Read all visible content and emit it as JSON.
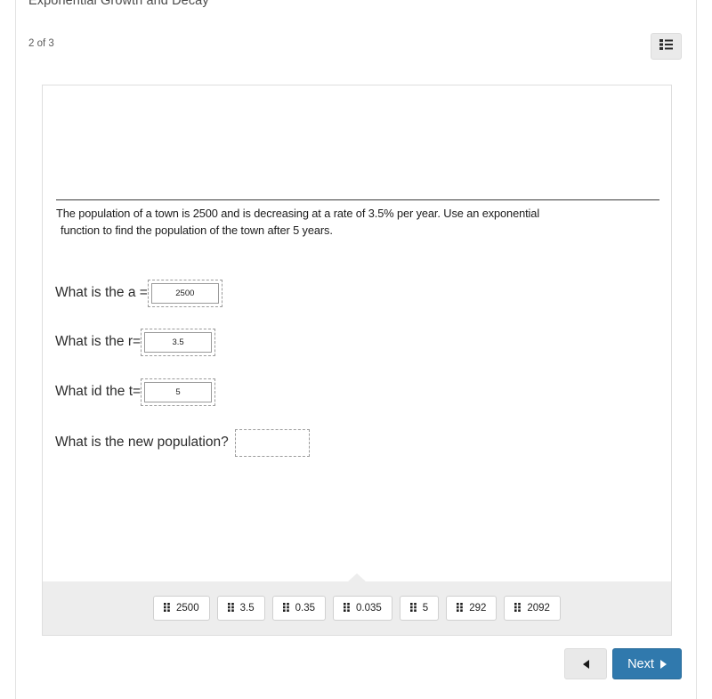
{
  "header": {
    "title": "Exponential Growth and Decay",
    "progress": "2 of 3",
    "menu_icon": "list-icon"
  },
  "prompt": {
    "line1": "The population of a town is 2500 and is decreasing at a rate of 3.5% per year.  Use an exponential",
    "line2": "function to find the population of the town after 5 years."
  },
  "questions": [
    {
      "label": "What is the a =",
      "value": "2500",
      "filled": true
    },
    {
      "label": "What is the r=",
      "value": "3.5",
      "filled": true
    },
    {
      "label": "What id the t=",
      "value": "5",
      "filled": true
    },
    {
      "label": "What is the new population?",
      "value": "",
      "filled": false
    }
  ],
  "tray": {
    "tokens": [
      {
        "label": "2500",
        "grip_icon": "drag-handle-icon"
      },
      {
        "label": "3.5",
        "grip_icon": "drag-handle-icon"
      },
      {
        "label": "0.35",
        "grip_icon": "drag-handle-icon"
      },
      {
        "label": "0.035",
        "grip_icon": "drag-handle-icon"
      },
      {
        "label": "5",
        "grip_icon": "drag-handle-icon"
      },
      {
        "label": "292",
        "grip_icon": "drag-handle-icon"
      },
      {
        "label": "2092",
        "grip_icon": "drag-handle-icon"
      }
    ]
  },
  "footer": {
    "back_icon": "triangle-left-icon",
    "next_label": "Next",
    "next_icon": "triangle-right-icon"
  },
  "colors": {
    "next_button": "#3079ad",
    "tray_background": "#ededed",
    "menu_button": "#eaeaea"
  }
}
